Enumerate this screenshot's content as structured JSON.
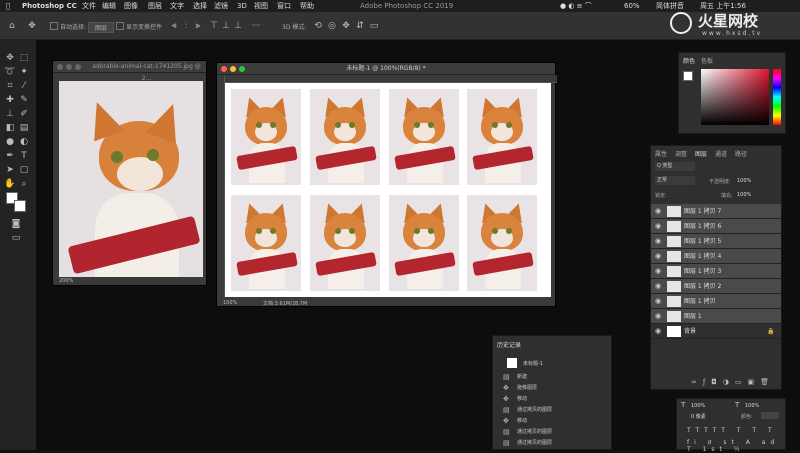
{
  "menubar": {
    "app": "Photoshop CC",
    "items": [
      "文件",
      "编辑",
      "图像",
      "图层",
      "文字",
      "选择",
      "滤镜",
      "3D",
      "视图",
      "窗口",
      "帮助"
    ],
    "window_title": "Adobe Photoshop CC 2019",
    "battery": "60%",
    "input_method": "简体拼音",
    "clock": "周五 上午1:56"
  },
  "watermark": {
    "brand": "火星网校",
    "url": "www.hxsd.tv"
  },
  "options_bar": {
    "auto_select_label": "自动选择:",
    "auto_select_value": "图层",
    "transform_label": "显示变换控件",
    "mode_3d": "3D 模式:"
  },
  "doc_left": {
    "title": "adorable-animal-cat-1741205.jpg @ 2...",
    "zoom": "200%"
  },
  "doc_main": {
    "title": "未标题-1 @ 100%(RGB/8) *",
    "zoom": "100%",
    "doc_info": "文档:3.61M/28.7M"
  },
  "color_panel": {
    "tabs": [
      "颜色",
      "色板"
    ],
    "accent": "#e0152f"
  },
  "layers_panel": {
    "tabs": [
      "属性",
      "调整",
      "图层",
      "通道",
      "路径"
    ],
    "filter_label": "Q 类型",
    "blend_mode": "正常",
    "opacity_label": "不透明度:",
    "opacity_value": "100%",
    "lock_label": "锁定:",
    "fill_label": "填充:",
    "fill_value": "100%",
    "layers": [
      {
        "name": "图层 1 拷贝 7"
      },
      {
        "name": "图层 1 拷贝 6"
      },
      {
        "name": "图层 1 拷贝 5"
      },
      {
        "name": "图层 1 拷贝 4"
      },
      {
        "name": "图层 1 拷贝 3"
      },
      {
        "name": "图层 1 拷贝 2"
      },
      {
        "name": "图层 1 拷贝"
      },
      {
        "name": "图层 1"
      },
      {
        "name": "背景"
      }
    ]
  },
  "history_panel": {
    "title": "历史记录",
    "snapshot": "未标题-1",
    "items": [
      "新建",
      "拖移图层",
      "移动",
      "通过拷贝的图层",
      "移动",
      "通过拷贝的图层",
      "通过拷贝的图层"
    ]
  },
  "char_panel": {
    "size_a": "100%",
    "size_b": "100%",
    "tracking": "0 像素",
    "color_label": "颜色:"
  }
}
